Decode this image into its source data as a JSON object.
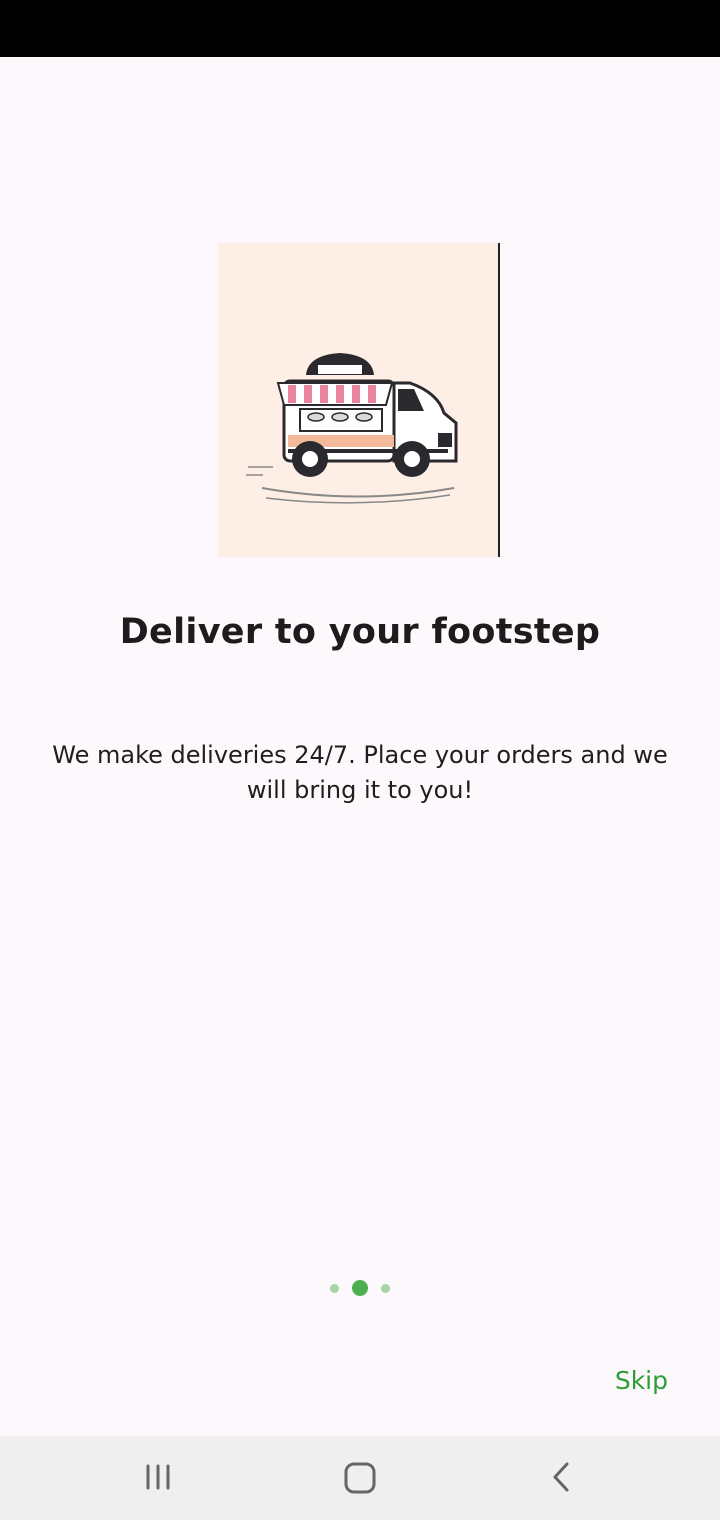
{
  "onboarding": {
    "title": "Deliver to your footstep",
    "description": "We make deliveries 24/7. Place your orders and we will bring it to you!",
    "illustration_icon": "food-truck-icon",
    "page_indicator": {
      "current": 2,
      "total": 3
    },
    "skip_label": "Skip"
  },
  "colors": {
    "accent": "#4caf50",
    "skip_text": "#2e9e36",
    "background": "#fdf8fb",
    "illustration_bg": "#fdefe5",
    "awning_pink": "#e8849c",
    "body_peach": "#f2b99a"
  },
  "navigation_bar": {
    "buttons": [
      "recent-apps-icon",
      "home-icon",
      "back-icon"
    ]
  }
}
